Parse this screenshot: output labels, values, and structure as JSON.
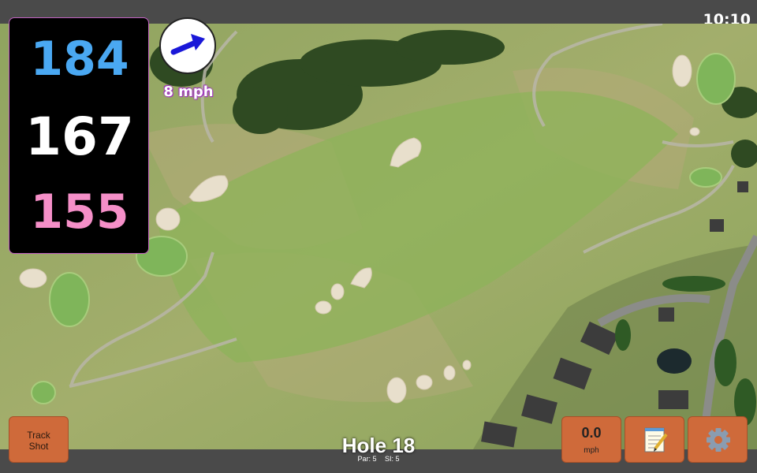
{
  "status": {
    "time": "10:10"
  },
  "distances": {
    "back": "184",
    "middle": "167",
    "front": "155"
  },
  "wind": {
    "speed": "8 mph",
    "direction_icon": "wind-arrow-icon"
  },
  "hole": {
    "title": "Hole 18",
    "par": "Par: 5",
    "si": "SI: 5"
  },
  "buttons": {
    "track_shot": "Track\nShot",
    "speed_value": "0.0",
    "speed_unit": "mph",
    "notes_icon": "notepad-icon",
    "settings_icon": "gear-icon"
  },
  "colors": {
    "back": "#4aa8f2",
    "middle": "#ffffff",
    "front": "#f58fc8",
    "button": "#cf6a3a",
    "bar": "#4a4a4a"
  }
}
